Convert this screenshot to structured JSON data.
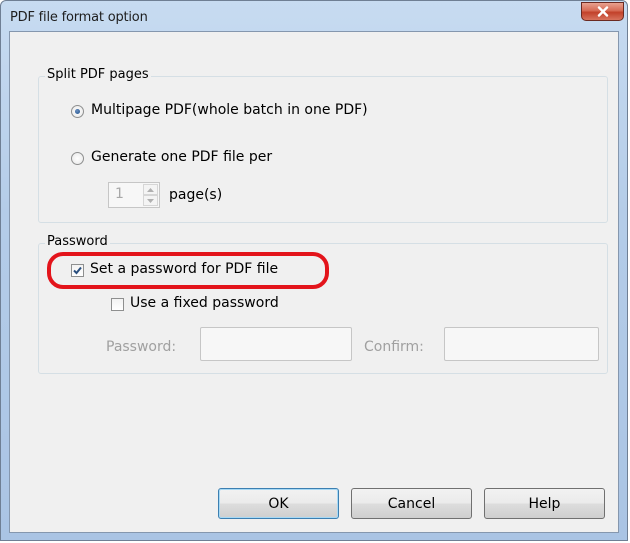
{
  "window": {
    "title": "PDF file format option"
  },
  "split_group": {
    "label": "Split PDF pages",
    "option_multipage": {
      "label": "Multipage PDF(whole batch in one PDF)",
      "selected": true
    },
    "option_per_page": {
      "label": "Generate one PDF file per",
      "selected": false
    },
    "pages_value": "1",
    "pages_unit": "page(s)"
  },
  "password_group": {
    "label": "Password",
    "set_password": {
      "label": "Set a password for PDF file",
      "checked": true
    },
    "fixed_password": {
      "label": "Use a fixed password",
      "checked": false
    },
    "password_label": "Password:",
    "confirm_label": "Confirm:"
  },
  "buttons": {
    "ok": "OK",
    "cancel": "Cancel",
    "help": "Help"
  },
  "colors": {
    "highlight": "#e3141b",
    "close_button": "#c2412a",
    "checkmark": "#2a4f7e"
  },
  "icons": {
    "close": "close-icon",
    "check": "checkmark-icon",
    "spin_up": "spin-up-arrow-icon",
    "spin_down": "spin-down-arrow-icon"
  }
}
